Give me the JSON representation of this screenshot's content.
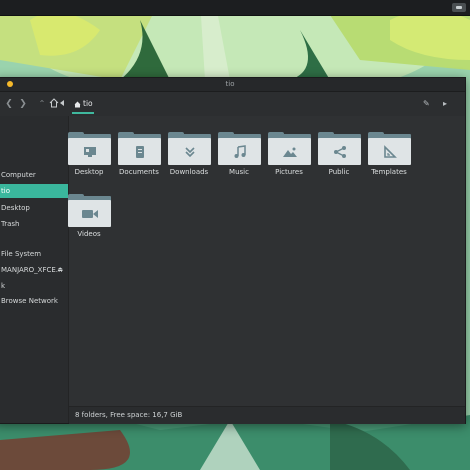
{
  "window": {
    "title": "tio"
  },
  "toolbar": {
    "crumb_label": "tio",
    "home_tooltip": "Home",
    "edit_icon": "pencil-icon",
    "tray_icon": "keyboard-icon"
  },
  "sidebar": {
    "items": [
      {
        "label": "Computer"
      },
      {
        "label": "tio"
      },
      {
        "label": "Desktop"
      },
      {
        "label": "Trash"
      },
      {
        "label": "File System"
      },
      {
        "label": "MANJARO_XFCE..."
      },
      {
        "label": "k"
      },
      {
        "label": "Browse Network"
      }
    ]
  },
  "folders": [
    {
      "name": "Desktop",
      "icon": "desktop-icon"
    },
    {
      "name": "Documents",
      "icon": "document-icon"
    },
    {
      "name": "Downloads",
      "icon": "download-icon"
    },
    {
      "name": "Music",
      "icon": "music-icon"
    },
    {
      "name": "Pictures",
      "icon": "picture-icon"
    },
    {
      "name": "Public",
      "icon": "share-icon"
    },
    {
      "name": "Templates",
      "icon": "template-icon"
    },
    {
      "name": "Videos",
      "icon": "video-icon"
    }
  ],
  "status": {
    "text": "8 folders, Free space: 16,7 GiB"
  },
  "colors": {
    "accent": "#3ab79d",
    "folder_tab": "#6b8790",
    "folder_body": "#dfe4e6"
  }
}
